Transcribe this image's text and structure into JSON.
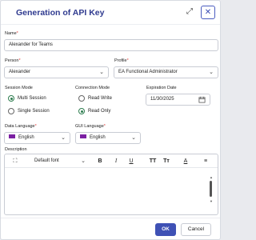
{
  "dialog": {
    "title": "Generation of API Key",
    "expand_icon": "expand-icon",
    "close_icon": "close-icon"
  },
  "form": {
    "name": {
      "label": "Name",
      "value": "Alexander for Teams"
    },
    "person": {
      "label": "Person",
      "value": "Alexander"
    },
    "profile": {
      "label": "Profile",
      "value": "EA Functional Administrator"
    },
    "session_mode": {
      "label": "Session Mode",
      "options": [
        {
          "label": "Multi Session",
          "selected": true
        },
        {
          "label": "Single Session",
          "selected": false
        }
      ]
    },
    "connection_mode": {
      "label": "Connection Mode",
      "options": [
        {
          "label": "Read Write",
          "selected": false
        },
        {
          "label": "Read Only",
          "selected": true
        }
      ]
    },
    "expiration_date": {
      "label": "Expiration Date",
      "value": "11/30/2025"
    },
    "data_language": {
      "label": "Data Language",
      "value": "English"
    },
    "gui_language": {
      "label": "GUI Language",
      "value": "English"
    },
    "description": {
      "label": "Description",
      "font_select": "Default font",
      "toolbar": [
        "fullscreen-icon",
        "bold-icon",
        "italic-icon",
        "underline-icon",
        "font-size-increase-icon",
        "font-size-decrease-icon",
        "text-color-icon",
        "align-icon"
      ]
    }
  },
  "footer": {
    "ok_label": "OK",
    "cancel_label": "Cancel"
  },
  "colors": {
    "accent": "#3f51b5",
    "title": "#2f3a8f",
    "radio": "#2e7d4f",
    "required": "#e53935"
  }
}
